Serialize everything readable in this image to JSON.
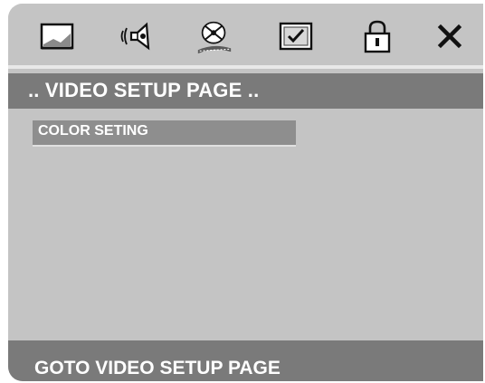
{
  "icon_bar": {
    "icons": [
      {
        "name": "tv-screen-icon",
        "state": "normal"
      },
      {
        "name": "speaker-audio-icon",
        "state": "normal"
      },
      {
        "name": "video-reel-icon",
        "state": "selected"
      },
      {
        "name": "checklist-preference-icon",
        "state": "normal"
      },
      {
        "name": "padlock-icon",
        "state": "normal"
      },
      {
        "name": "close-exit-icon",
        "state": "normal"
      }
    ]
  },
  "title_bar": {
    "title": ".. VIDEO SETUP PAGE .."
  },
  "menu": {
    "items": [
      {
        "label": "COLOR SETING",
        "highlighted": true
      }
    ]
  },
  "status_bar": {
    "text": "GOTO VIDEO SETUP PAGE"
  },
  "colors": {
    "panel": "#c4c4c4",
    "bar": "#7a7a7a",
    "highlight": "#8e8e8e",
    "text": "#ffffff"
  }
}
